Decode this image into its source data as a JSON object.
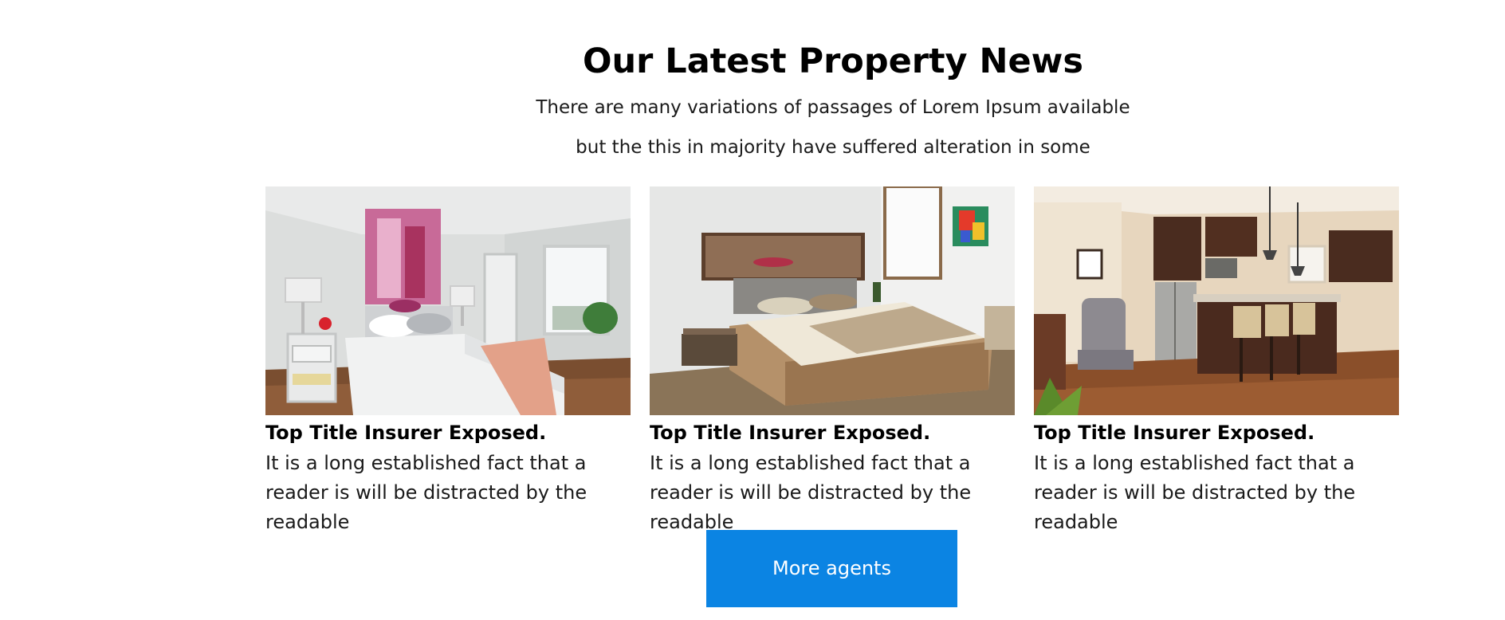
{
  "section": {
    "title": "Our Latest Property News",
    "subtitle_line1": "There are many variations of passages of Lorem Ipsum available",
    "subtitle_line2": "but the this in majority have suffered alteration in some"
  },
  "cards": [
    {
      "title": "Top Title Insurer Exposed.",
      "text": "It is a long established fact that a reader is will be distracted by the readable",
      "image": "bedroom-photo"
    },
    {
      "title": "Top Title Insurer Exposed.",
      "text": "It is a long established fact that a reader is will be distracted by the readable",
      "image": "modern-bedroom-photo"
    },
    {
      "title": "Top Title Insurer Exposed.",
      "text": "It is a long established fact that a reader is will be distracted by the readable",
      "image": "kitchen-photo"
    }
  ],
  "more_button": {
    "label": "More agents",
    "color": "#0b84e3"
  }
}
